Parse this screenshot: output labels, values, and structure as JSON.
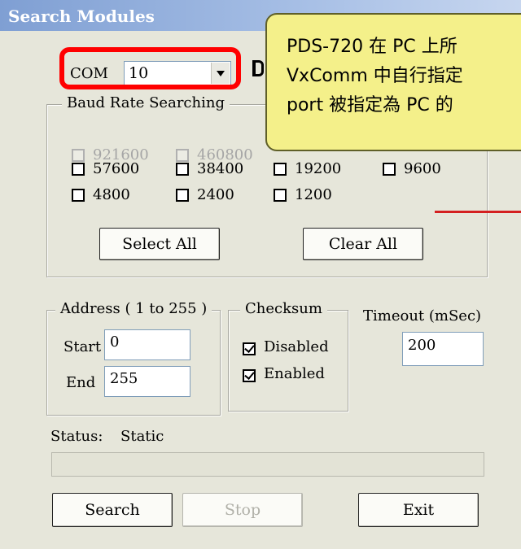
{
  "window": {
    "title": "Search Modules"
  },
  "com": {
    "label": "COM",
    "value": "10"
  },
  "callout": {
    "lines": [
      "PDS-720 在 PC 上所",
      "VxComm 中自行指定",
      "port 被指定為 PC 的"
    ]
  },
  "baud": {
    "legend": "Baud Rate Searching",
    "disabled": [
      "921600",
      "460800"
    ],
    "rates": [
      "57600",
      "38400",
      "19200",
      "9600",
      "4800",
      "2400",
      "1200"
    ],
    "select_all": "Select All",
    "clear_all": "Clear All"
  },
  "address": {
    "legend": "Address ( 1 to 255 )",
    "start_label": "Start",
    "start_value": "0",
    "end_label": "End",
    "end_value": "255"
  },
  "checksum": {
    "legend": "Checksum",
    "disabled_label": "Disabled",
    "enabled_label": "Enabled",
    "disabled_checked": true,
    "enabled_checked": true
  },
  "timeout": {
    "label": "Timeout (mSec)",
    "value": "200"
  },
  "status": {
    "label": "Status:",
    "value": "Static"
  },
  "buttons": {
    "search": "Search",
    "stop": "Stop",
    "exit": "Exit"
  }
}
